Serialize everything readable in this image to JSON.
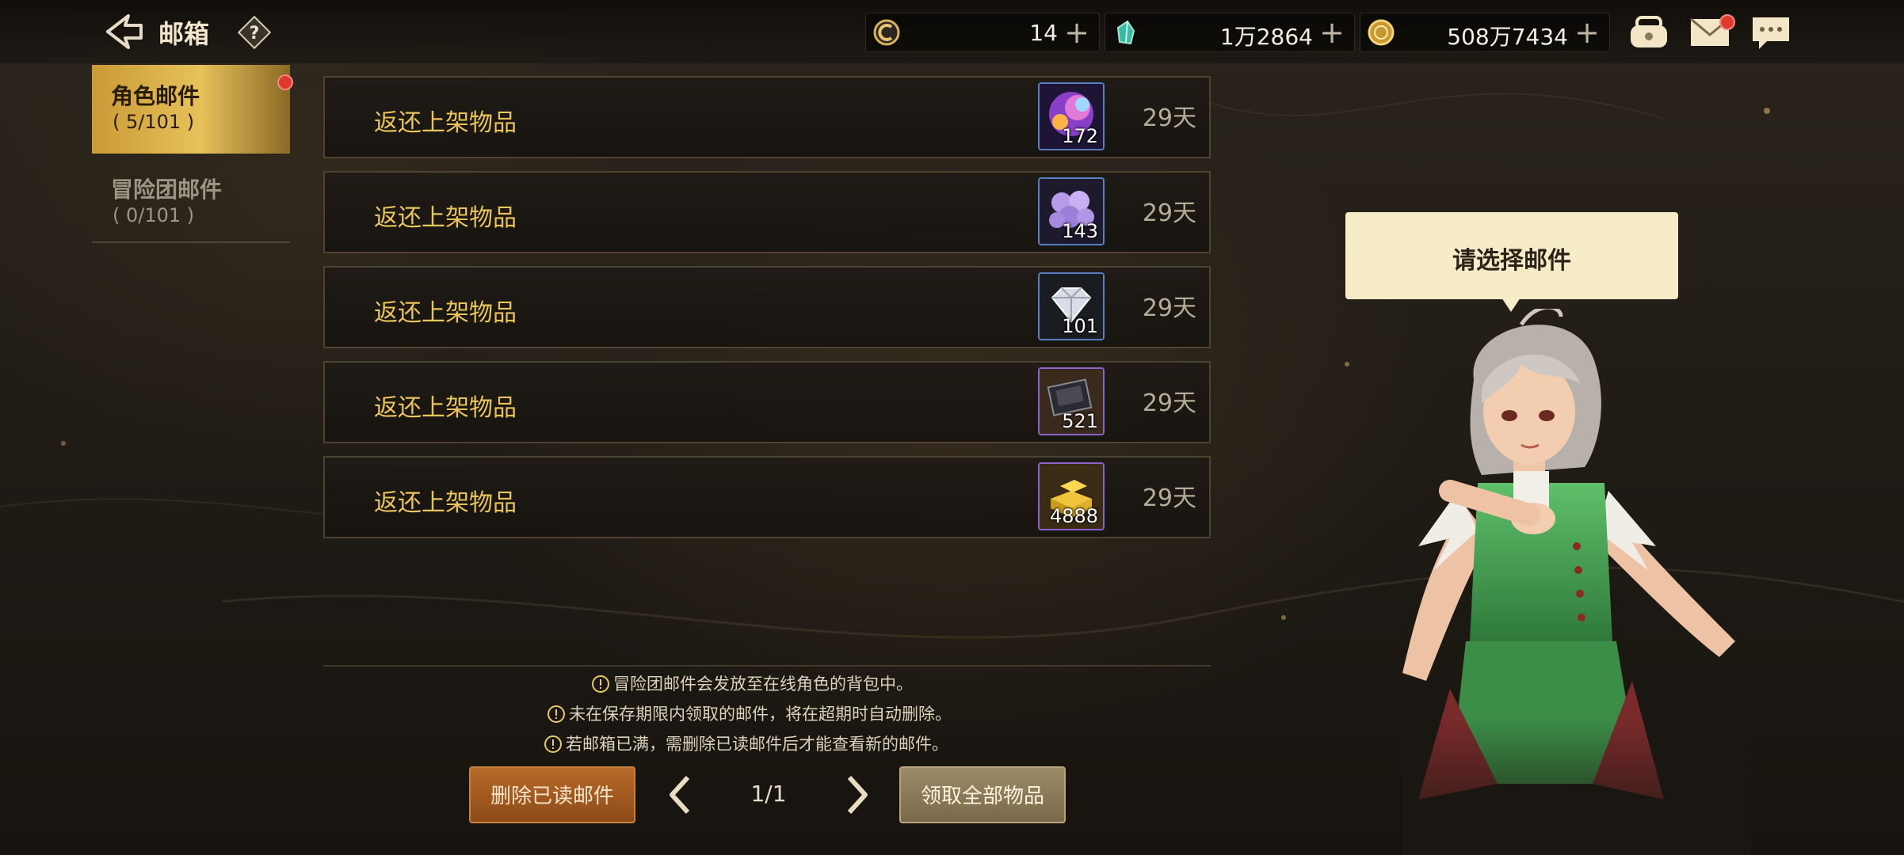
{
  "header": {
    "title": "邮箱"
  },
  "currencies": [
    {
      "icon": "ticket-coin-icon",
      "value": "14"
    },
    {
      "icon": "crystal-icon",
      "value": "1万2864"
    },
    {
      "icon": "gold-coin-icon",
      "value": "508万7434"
    }
  ],
  "sidebar": {
    "tabs": [
      {
        "label": "角色邮件",
        "count": "( 5/101 )"
      },
      {
        "label": "冒险团邮件",
        "count": "( 0/101 )"
      }
    ]
  },
  "mails": [
    {
      "subject": "返还上架物品",
      "item_icon": "orb-icon",
      "quantity": "172",
      "days": "29天"
    },
    {
      "subject": "返还上架物品",
      "item_icon": "purple-beads-icon",
      "quantity": "143",
      "days": "29天"
    },
    {
      "subject": "返还上架物品",
      "item_icon": "diamond-icon",
      "quantity": "101",
      "days": "29天"
    },
    {
      "subject": "返还上架物品",
      "item_icon": "dark-card-icon",
      "quantity": "521",
      "days": "29天"
    },
    {
      "subject": "返还上架物品",
      "item_icon": "gold-bars-icon",
      "quantity": "4888",
      "days": "29天"
    }
  ],
  "notices": [
    "冒险团邮件会发放至在线角色的背包中。",
    "未在保存期限内领取的邮件，将在超期时自动删除。",
    "若邮箱已满，需删除已读邮件后才能查看新的邮件。"
  ],
  "footer": {
    "delete_label": "删除已读邮件",
    "page": "1/1",
    "claim_all_label": "领取全部物品"
  },
  "bubble": {
    "text": "请选择邮件"
  },
  "colors": {
    "accent_gold": "#e9c45a",
    "tab_active": "#e7c15a",
    "delete_btn": "#a55c22"
  }
}
